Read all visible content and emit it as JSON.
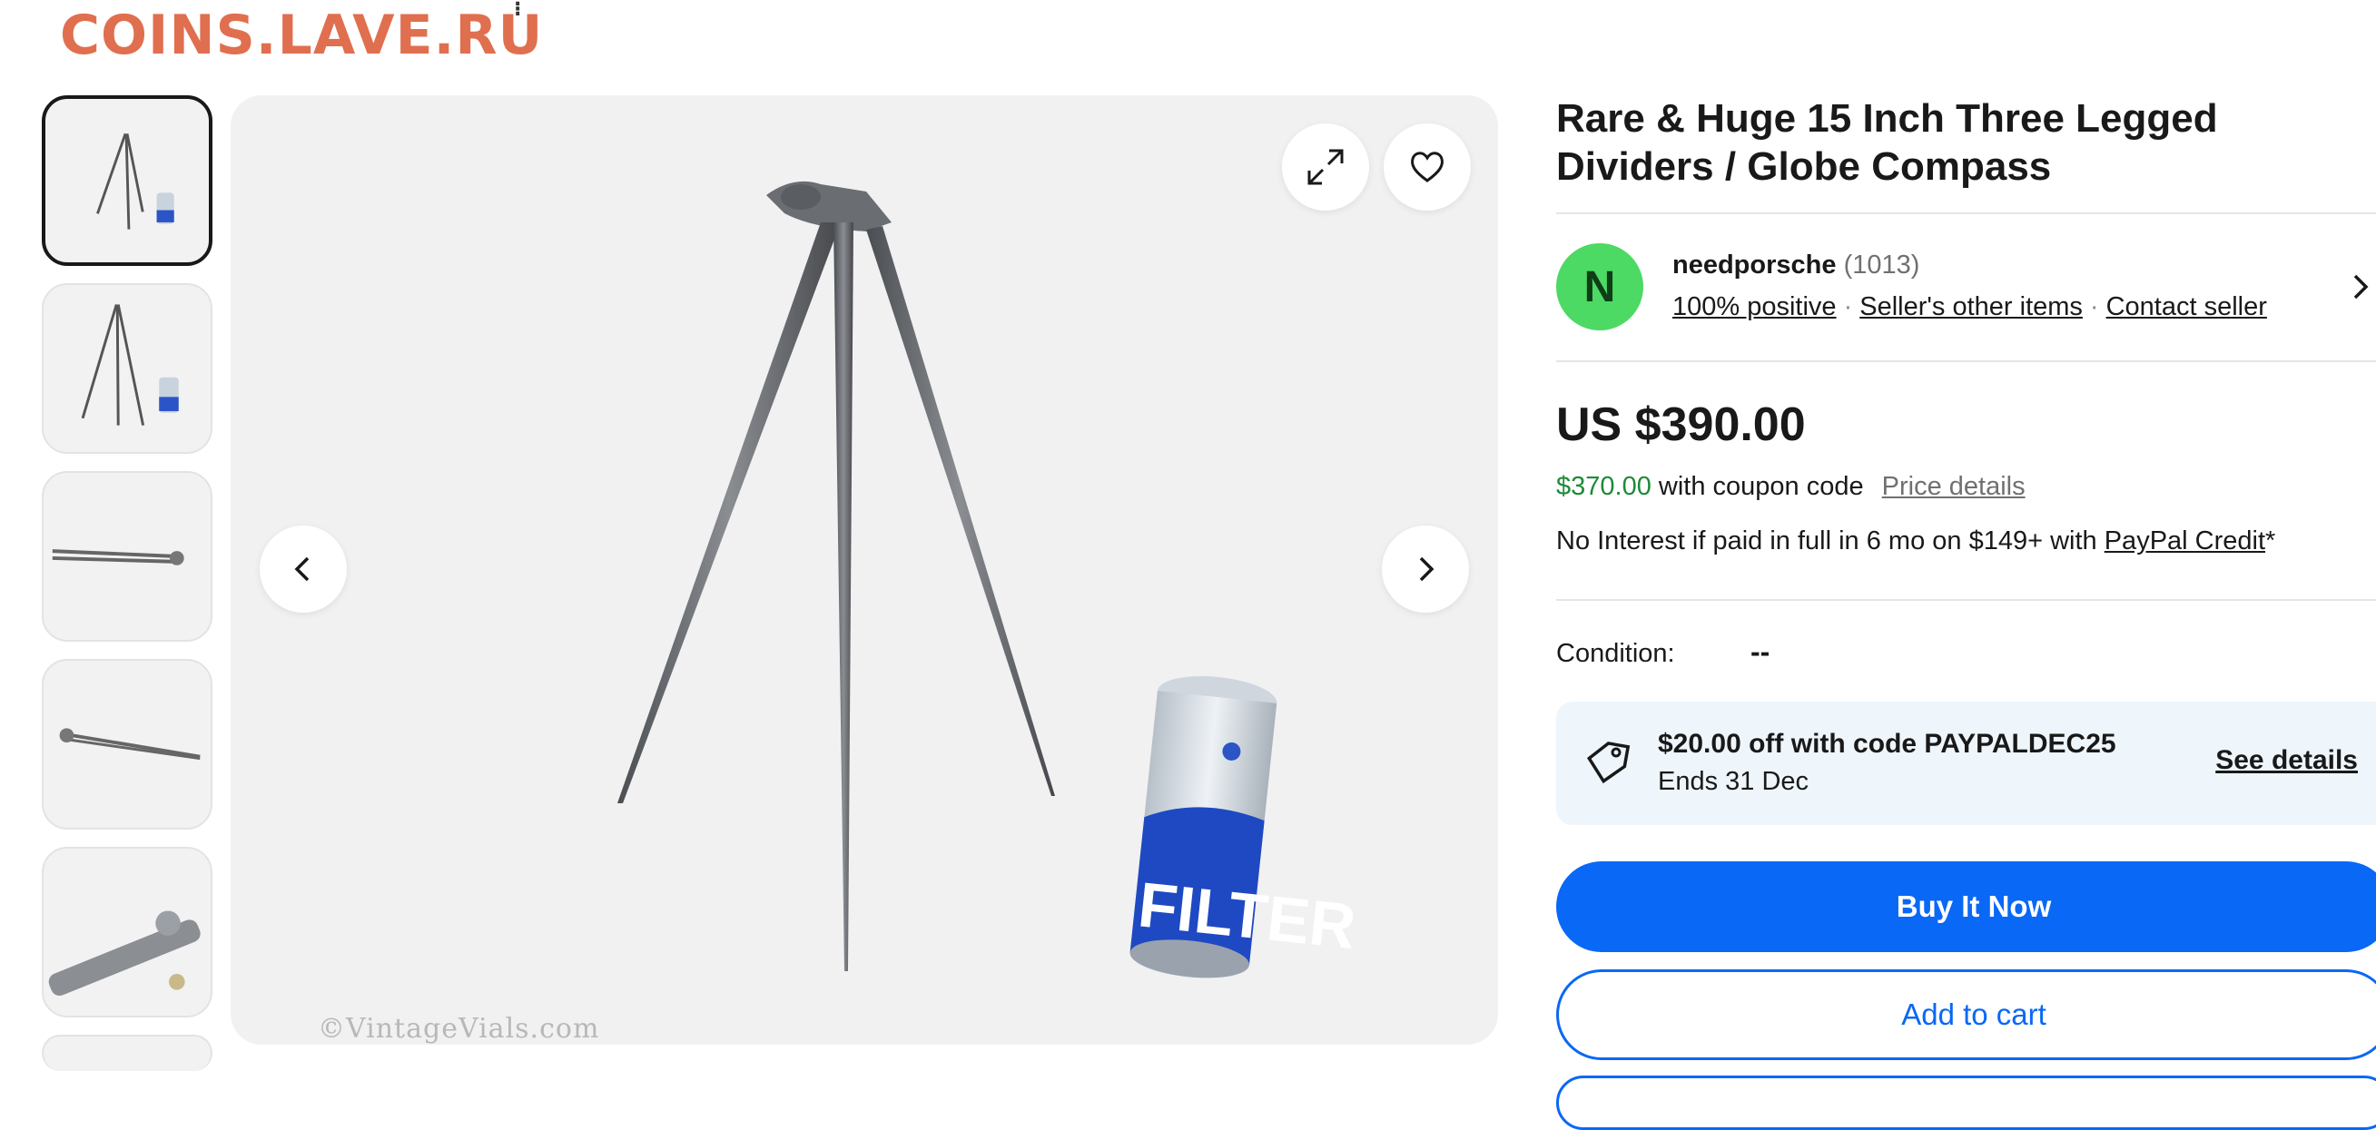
{
  "watermark": {
    "text": "COINS.LAVE.RU",
    "dot": "⁝"
  },
  "gallery": {
    "thumbnails": [
      {
        "name": "thumb-1",
        "selected": true
      },
      {
        "name": "thumb-2",
        "selected": false
      },
      {
        "name": "thumb-3",
        "selected": false
      },
      {
        "name": "thumb-4",
        "selected": false
      },
      {
        "name": "thumb-5",
        "selected": false
      }
    ],
    "copyright": "©VintageVials.com",
    "can_label": "FILTER",
    "icons": {
      "expand": "expand-icon",
      "favorite": "heart-icon",
      "prev": "chevron-left-icon",
      "next": "chevron-right-icon"
    }
  },
  "listing": {
    "title": "Rare & Huge 15 Inch Three Legged Dividers / Globe Compass",
    "seller": {
      "avatar_letter": "N",
      "avatar_color": "#4cd964",
      "name": "needporsche",
      "feedback_count": "(1013)",
      "positive": "100% positive",
      "other_items": "Seller's other items",
      "contact": "Contact seller"
    },
    "price": "US $390.00",
    "coupon_price": "$370.00",
    "coupon_text": "with coupon code",
    "price_details": "Price details",
    "credit_text": "No Interest if paid in full in 6 mo on $149+ with",
    "credit_link": "PayPal Credit",
    "credit_suffix": "*",
    "condition_label": "Condition:",
    "condition_value": "--",
    "promo": {
      "headline": "$20.00 off with code PAYPALDEC25",
      "ends": "Ends 31 Dec",
      "see_details": "See details"
    },
    "buttons": {
      "buy": "Buy It Now",
      "cart": "Add to cart"
    },
    "colors": {
      "accent": "#0968f6",
      "promo_bg": "#eef6fc",
      "coupon_green": "#1f8a3a",
      "watermark": "#e06f4f"
    }
  }
}
